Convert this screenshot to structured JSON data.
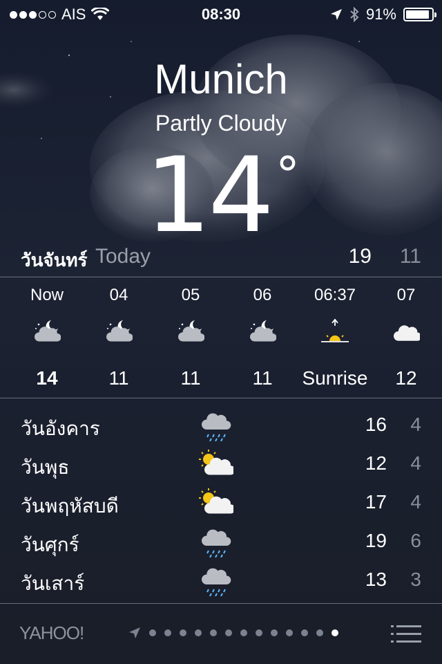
{
  "status_bar": {
    "carrier": "AIS",
    "time": "08:30",
    "battery_percent_text": "91%",
    "battery_level": 0.91,
    "signal_bars_filled": 3,
    "signal_bars_total": 5
  },
  "header": {
    "city": "Munich",
    "condition": "Partly Cloudy",
    "temperature": "14",
    "degree_symbol": "°"
  },
  "today": {
    "day_name": "วันจันทร์",
    "label": "Today",
    "high": "19",
    "low": "11"
  },
  "hourly": [
    {
      "time": "Now",
      "icon": "partly-cloudy-night-icon",
      "value": "14",
      "bold": true
    },
    {
      "time": "04",
      "icon": "partly-cloudy-night-icon",
      "value": "11",
      "bold": false
    },
    {
      "time": "05",
      "icon": "partly-cloudy-night-icon",
      "value": "11",
      "bold": false
    },
    {
      "time": "06",
      "icon": "partly-cloudy-night-icon",
      "value": "11",
      "bold": false
    },
    {
      "time": "06:37",
      "icon": "sunrise-icon",
      "value": "Sunrise",
      "bold": false
    },
    {
      "time": "07",
      "icon": "cloudy-icon",
      "value": "12",
      "bold": false
    }
  ],
  "daily": [
    {
      "day": "วันอังคาร",
      "icon": "rain-icon",
      "high": "16",
      "low": "4"
    },
    {
      "day": "วันพุธ",
      "icon": "partly-sunny-icon",
      "high": "12",
      "low": "4"
    },
    {
      "day": "วันพฤหัสบดี",
      "icon": "partly-sunny-icon",
      "high": "17",
      "low": "4"
    },
    {
      "day": "วันศุกร์",
      "icon": "rain-icon",
      "high": "19",
      "low": "6"
    },
    {
      "day": "วันเสาร์",
      "icon": "rain-icon",
      "high": "13",
      "low": "3"
    }
  ],
  "footer": {
    "brand": "YAHOO!",
    "page_count": 13,
    "active_page": 13,
    "location_icon": "location-arrow-icon",
    "list_icon": "list-icon"
  },
  "colors": {
    "sun": "#f5c518",
    "cloud_light": "#f2f2f2",
    "cloud_gray": "#b9bcc3",
    "rain": "#5db7ff",
    "dim_text": "#8a909b"
  }
}
